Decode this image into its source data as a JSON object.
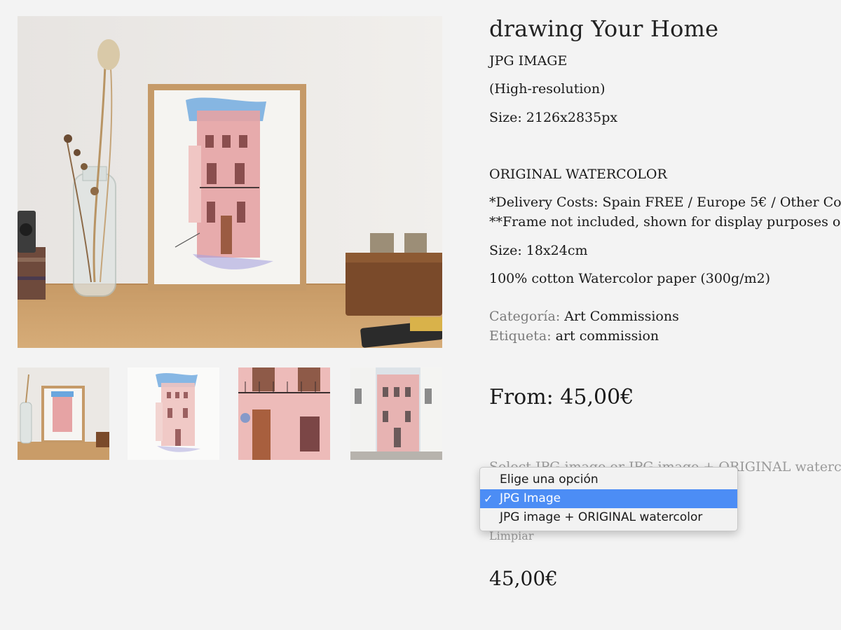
{
  "product": {
    "title": "drawing Your Home",
    "jpg_heading": "JPG IMAGE",
    "jpg_resolution": "(High-resolution)",
    "jpg_size": "Size: 2126x2835px",
    "original_heading": "ORIGINAL WATERCOLOR",
    "delivery_costs": "*Delivery Costs: Spain FREE / Europe 5€ / Other Cou",
    "frame_note": "**Frame not included, shown for display purposes or",
    "original_size": "Size: 18x24cm",
    "paper": "100% cotton Watercolor paper (300g/m2)",
    "category_label": "Categoría:",
    "category_value": "Art Commissions",
    "tag_label": "Etiqueta:",
    "tag_value": "art commission",
    "price_from": "From: 45,00€",
    "select_label": "Select JPG image or JPG image + ORIGINAL watercolo",
    "clear_link": "Limpiar",
    "price_final": "45,00€"
  },
  "dropdown": {
    "options": [
      {
        "label": "Elige una opción",
        "selected": false
      },
      {
        "label": "JPG Image",
        "selected": true
      },
      {
        "label": "JPG image + ORIGINAL watercolor",
        "selected": false
      }
    ],
    "check_mark": "✓",
    "selected_color": "#4c8df5"
  },
  "gallery": {
    "thumbnails": [
      "framed-drawing-on-desk",
      "watercolor-drawing-full",
      "facade-detail-closeup",
      "street-photo"
    ]
  }
}
